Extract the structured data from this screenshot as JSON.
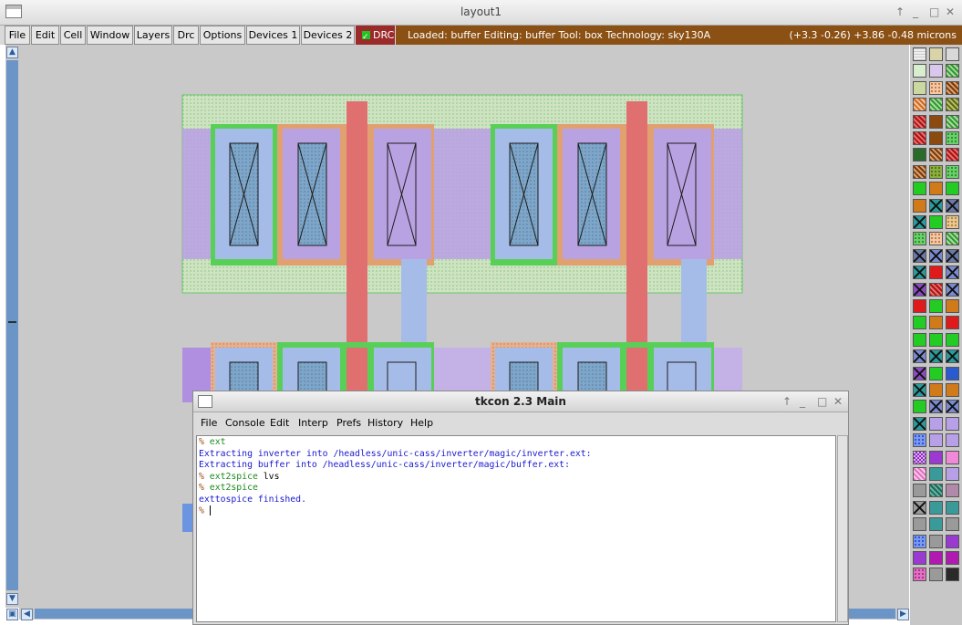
{
  "window": {
    "title": "layout1",
    "controls": [
      "↑",
      "_",
      "□",
      "✕"
    ]
  },
  "menu": [
    "File",
    "Edit",
    "Cell",
    "Window",
    "Layers",
    "Drc",
    "Options",
    "Devices 1",
    "Devices 2"
  ],
  "drc_toggle": {
    "label": "DRC",
    "checked": true
  },
  "status": {
    "left": "Loaded: buffer Editing: buffer Tool: box  Technology: sky130A",
    "right": "(+3.3 -0.26) +3.86 -0.48 microns"
  },
  "tkcon": {
    "title": "tkcon 2.3 Main",
    "controls": [
      "↑",
      "_",
      "□",
      "✕"
    ],
    "menu": [
      "File",
      "Console",
      "Edit",
      "Interp",
      "Prefs",
      "History",
      "Help"
    ],
    "prompt": "% ",
    "lines": [
      {
        "kind": "cmd",
        "text": "ext"
      },
      {
        "kind": "out",
        "text": "Extracting inverter into /headless/unic-cass/inverter/magic/inverter.ext:"
      },
      {
        "kind": "out",
        "text": "Extracting buffer into /headless/unic-cass/inverter/magic/buffer.ext:"
      },
      {
        "kind": "cmd",
        "text": "ext2spice",
        "arg": " lvs"
      },
      {
        "kind": "cmd",
        "text": "ext2spice"
      },
      {
        "kind": "out",
        "text": "exttospice finished."
      },
      {
        "kind": "prompt",
        "text": ""
      }
    ]
  },
  "colors": {
    "canvas": "#c9c9c9",
    "status_bar": "#8b5014",
    "drc_bg": "#9b2a2a",
    "scroll_thumb": "#6b95c7",
    "nwell": "#cfe3c2",
    "diffusion_green": "#58d058",
    "poly_red": "#e07070",
    "li_purple": "#b08ee0",
    "metal_blue": "#a6bce8",
    "ndiff_orange": "#e0a070",
    "prompt": "#a24a1b",
    "command": "#1e8a1e",
    "output": "#1a1ad0"
  },
  "palette_icons": [
    "grid-pattern",
    "tan-fill",
    "gray-box",
    "green-outline",
    "violet-box",
    "green-hatch",
    "green-tan",
    "orange-dot",
    "brown-hatch",
    "orange-hatch",
    "green-hatch",
    "olive-hatch",
    "red-hatch",
    "brown-solid",
    "green-hatch",
    "red-hatch",
    "brown-solid",
    "green-dot",
    "dark-green",
    "brown-hatch",
    "red-hatch",
    "brown-hatch",
    "olive-dot",
    "green-dot",
    "green-solid",
    "orange-solid",
    "green-solid",
    "orange-solid",
    "teal-x",
    "slate-x",
    "teal-x",
    "green-solid",
    "tan-dot",
    "green-dot",
    "orange-dot",
    "green-hatch",
    "slate-x",
    "blue-x",
    "slate-x",
    "teal-x",
    "red-solid",
    "blue-x",
    "purple-x",
    "red-hatch",
    "blue-x",
    "red-solid",
    "green-solid",
    "orange-solid",
    "green-solid",
    "orange-solid",
    "red-solid",
    "green-solid",
    "green-solid",
    "green-solid",
    "blue-x",
    "teal-x",
    "teal-x",
    "purple-x",
    "green-solid",
    "blue-solid",
    "teal-x",
    "orange-solid",
    "orange-solid",
    "green-solid",
    "blue-x",
    "blue-x",
    "teal-x",
    "lavender",
    "lavender",
    "blue-dot",
    "lavender",
    "lavender",
    "checker",
    "purple-solid",
    "pink-solid",
    "pink-hatch",
    "teal-solid",
    "lavender",
    "gray-solid",
    "teal-hatch",
    "mauve",
    "gray-x",
    "teal-solid",
    "teal-solid",
    "gray-solid",
    "teal-solid",
    "gray-solid",
    "blue-dot",
    "gray-solid",
    "purple-solid",
    "purple-solid",
    "magenta",
    "magenta",
    "pink-dot",
    "gray-solid",
    "black-box"
  ]
}
